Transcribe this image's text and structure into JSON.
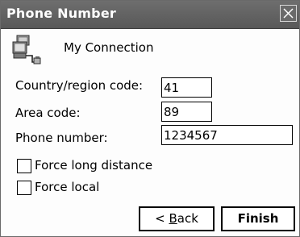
{
  "window": {
    "title": "Phone Number"
  },
  "connection": {
    "name": "My Connection",
    "icon": "network-connection-icon"
  },
  "fields": {
    "country_label": "Country/region code:",
    "country_value": "41",
    "area_label": "Area code:",
    "area_value": "89",
    "phone_label": "Phone number:",
    "phone_value": "1234567"
  },
  "options": {
    "force_long_distance_label": "Force long distance",
    "force_long_distance_checked": false,
    "force_local_label": "Force local",
    "force_local_checked": false
  },
  "buttons": {
    "back_prefix": "< ",
    "back_mnemonic": "B",
    "back_rest": "ack",
    "finish_label": "Finish"
  },
  "colors": {
    "titlebar": "#606060",
    "title_text": "#ffffff",
    "background": "#fdfdfd"
  }
}
